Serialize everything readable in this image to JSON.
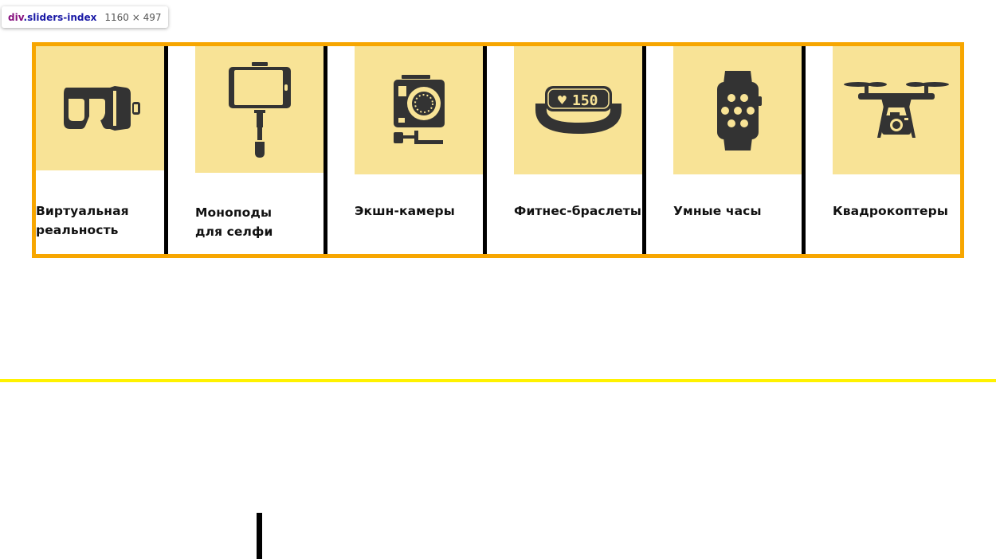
{
  "inspector_tooltip": {
    "tag": "div",
    "class_name": ".sliders-index",
    "dimensions": "1160 × 497"
  },
  "colors": {
    "container_border": "#f7a600",
    "tile_background": "#f8e396",
    "icon_fill": "#333333",
    "highlight_line": "#fff200"
  },
  "categories": [
    {
      "label": "Виртуальная\nреальность",
      "icon": "vr-headset-icon"
    },
    {
      "label": "Моноподы\nдля селфи",
      "icon": "selfie-stick-icon"
    },
    {
      "label": "Экшн-камеры",
      "icon": "action-camera-icon"
    },
    {
      "label": "Фитнес-браслеты",
      "icon": "fitness-band-icon"
    },
    {
      "label": "Умные часы",
      "icon": "smartwatch-icon"
    },
    {
      "label": "Квадрокоптеры",
      "icon": "drone-icon"
    }
  ],
  "fitness_band_display": "150"
}
